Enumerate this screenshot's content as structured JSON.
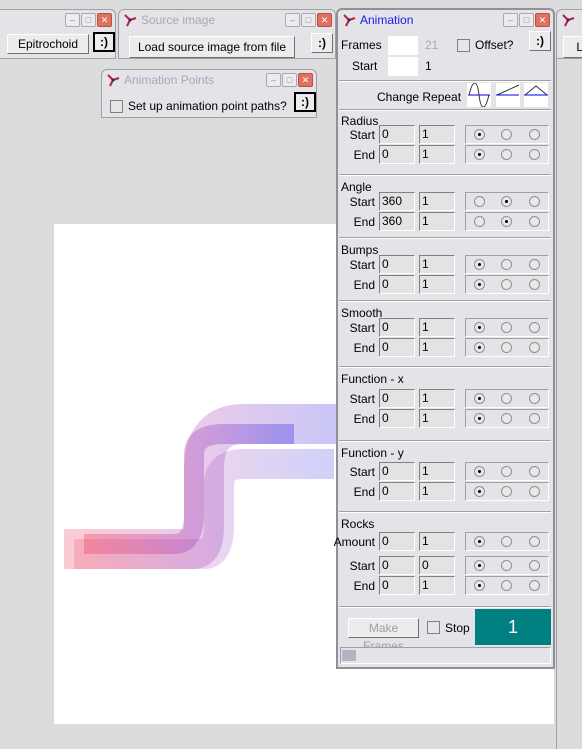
{
  "windows": {
    "partial": {
      "button": "Epitrochoid",
      "smile": ":)"
    },
    "source": {
      "title": "Source image",
      "load": "Load source image from file",
      "smile": ":)"
    },
    "points": {
      "title": "Animation Points",
      "checkbox": "Set up animation point paths?",
      "smile": ":)"
    },
    "right": {
      "button": "Lo"
    }
  },
  "animation": {
    "title": "Animation",
    "frames_label": "Frames",
    "frames_value": "21",
    "start_label": "Start",
    "start_value": "1",
    "offset_label": "Offset?",
    "smile": ":)",
    "change_repeat": "Change Repeat",
    "repeat_icons": [
      "sine-wave-icon",
      "ramp-icon",
      "triangle-icon"
    ],
    "sections": [
      {
        "title": "Radius",
        "rows": [
          {
            "label": "Start",
            "a": "0",
            "b": "1",
            "sel": 0
          },
          {
            "label": "End",
            "a": "0",
            "b": "1",
            "sel": 0
          }
        ]
      },
      {
        "title": "Angle",
        "rows": [
          {
            "label": "Start",
            "a": "360",
            "b": "1",
            "sel": 1
          },
          {
            "label": "End",
            "a": "360",
            "b": "1",
            "sel": 1
          }
        ]
      },
      {
        "title": "Bumps",
        "rows": [
          {
            "label": "Start",
            "a": "0",
            "b": "1",
            "sel": 0
          },
          {
            "label": "End",
            "a": "0",
            "b": "1",
            "sel": 0
          }
        ]
      },
      {
        "title": "Smooth",
        "rows": [
          {
            "label": "Start",
            "a": "0",
            "b": "1",
            "sel": 0
          },
          {
            "label": "End",
            "a": "0",
            "b": "1",
            "sel": 0
          }
        ]
      },
      {
        "title": "Function - x",
        "rows": [
          {
            "label": "Start",
            "a": "0",
            "b": "1",
            "sel": 0
          },
          {
            "label": "End",
            "a": "0",
            "b": "1",
            "sel": 0
          }
        ]
      },
      {
        "title": "Function - y",
        "rows": [
          {
            "label": "Start",
            "a": "0",
            "b": "1",
            "sel": 0
          },
          {
            "label": "End",
            "a": "0",
            "b": "1",
            "sel": 0
          }
        ]
      },
      {
        "title": "Rocks",
        "rows": [
          {
            "label": "Amount",
            "a": "0",
            "b": "1",
            "sel": 0
          },
          {
            "label": "Start",
            "a": "0",
            "b": "0",
            "sel": 0
          },
          {
            "label": "End",
            "a": "0",
            "b": "1",
            "sel": 0
          }
        ]
      }
    ],
    "make_frames": "Make Frames",
    "stop_label": "Stop",
    "counter": "1",
    "counter_color": "#008080",
    "progress": 0.03
  }
}
